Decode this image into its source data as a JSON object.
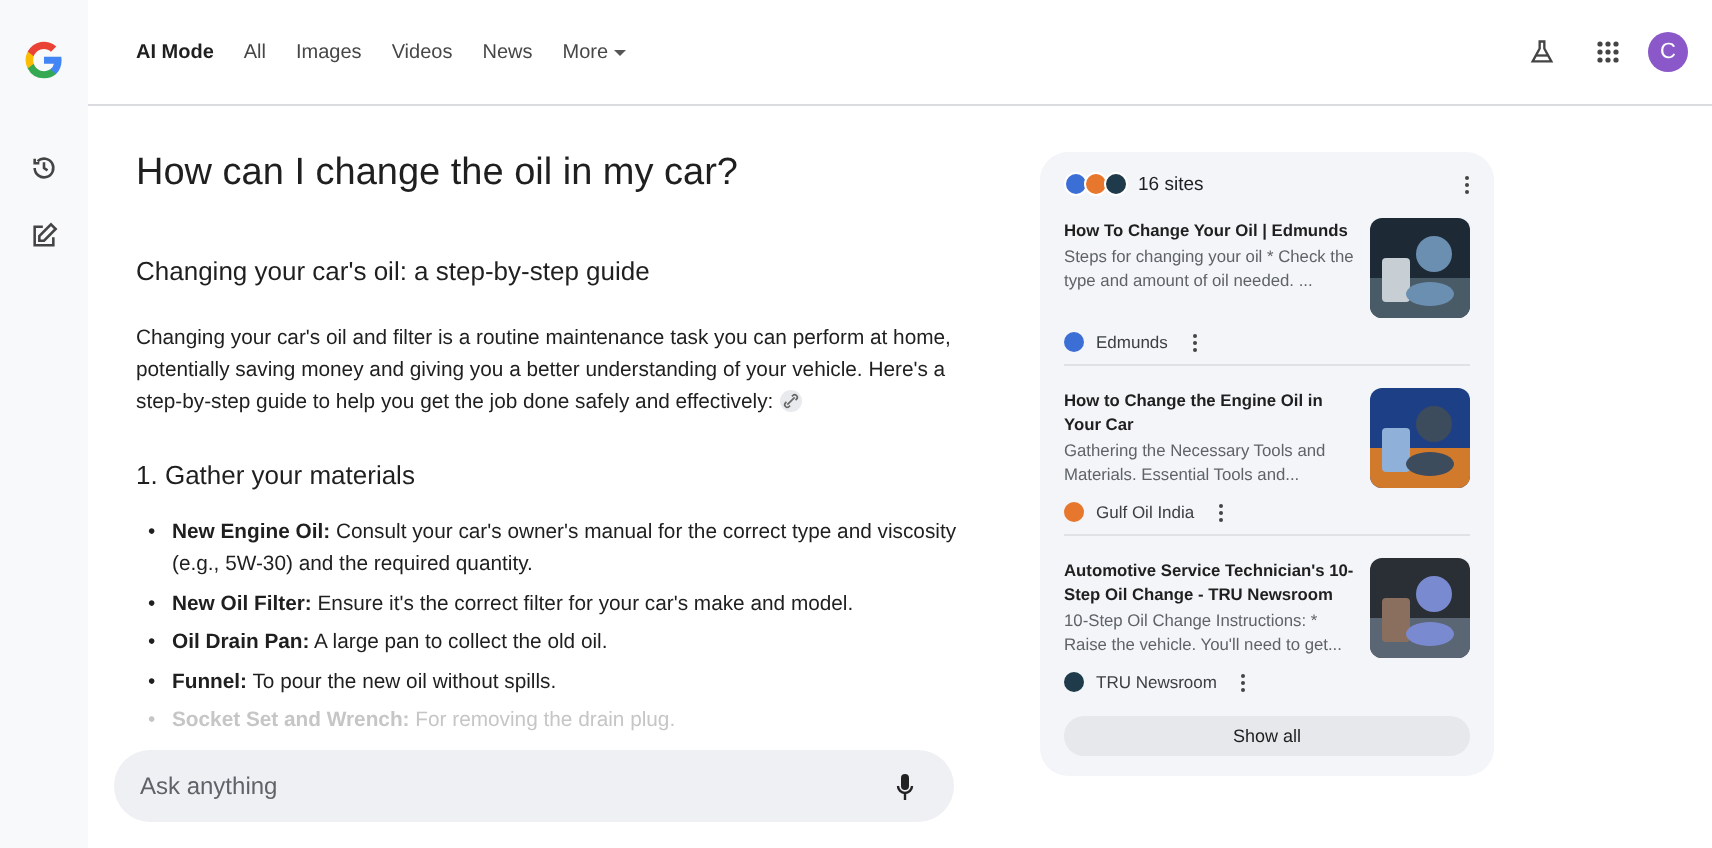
{
  "header": {
    "tabs": [
      {
        "label": "AI Mode",
        "selected": true
      },
      {
        "label": "All",
        "selected": false
      },
      {
        "label": "Images",
        "selected": false
      },
      {
        "label": "Videos",
        "selected": false
      },
      {
        "label": "News",
        "selected": false
      },
      {
        "label": "More",
        "selected": false,
        "dropdown": true
      }
    ],
    "avatar": "C"
  },
  "answer": {
    "question": "How can I change the oil in my car?",
    "heading": "Changing your car's oil: a step-by-step guide",
    "intro": "Changing your car's oil and filter is a routine maintenance task you can perform at home, potentially saving money and giving you a better understanding of your vehicle. Here's a step-by-step guide to help you get the job done safely and effectively:",
    "section": "1. Gather your materials",
    "items": [
      {
        "marker": "•",
        "text": "**New Engine Oil:** Consult your car's owner's manual for the correct type and viscosity (e.g., 5W-30) and the required quantity.",
        "faded": false
      },
      {
        "marker": "•",
        "text": "**New Oil Filter:** Ensure it's the correct filter for your car's make and model.",
        "faded": false
      },
      {
        "marker": "•",
        "text": "**Oil Drain Pan:** A large pan to collect the old oil.",
        "faded": false
      },
      {
        "marker": "•",
        "text": "**Funnel:** To pour the new oil without spills.",
        "faded": false
      },
      {
        "marker": "•",
        "text": "**Socket Set and Wrench:** For removing the drain plug.",
        "faded": true
      }
    ]
  },
  "ask": {
    "placeholder": "Ask anything"
  },
  "sources": {
    "count": "16 sites",
    "cards": [
      {
        "title": "How To Change Your Oil | Edmunds",
        "snippet": "Steps for changing your oil * Check the type and amount of oil needed. ...",
        "site": "Edmunds",
        "color": "#3b6fd6"
      },
      {
        "title": "How to Change the Engine Oil in Your Car",
        "snippet": "Gathering the Necessary Tools and Materials. Essential Tools and...",
        "site": "Gulf Oil India",
        "color": "#e8772e"
      },
      {
        "title": "Automotive Service Technician's 10-Step Oil Change - TRU Newsroom",
        "snippet": "10-Step Oil Change Instructions: * Raise the vehicle. You'll need to get...",
        "site": "TRU Newsroom",
        "color": "#1f3a4a"
      }
    ],
    "show_all": "Show all"
  }
}
